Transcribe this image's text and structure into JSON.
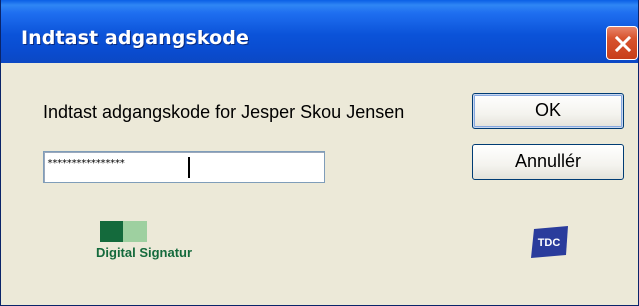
{
  "window": {
    "title": "Indtast adgangskode"
  },
  "dialog": {
    "prompt": "Indtast adgangskode for Jesper Skou Jensen",
    "password_masked": "****************",
    "ok_label": "OK",
    "cancel_label": "Annullér"
  },
  "logos": {
    "digital_signatur_text": "Digital Signatur",
    "tdc_text": "TDC"
  },
  "colors": {
    "titlebar": "#0b53d9",
    "dialog_background": "#ece9d8",
    "close_button": "#d8542f",
    "digital_signatur_green": "#146a3c",
    "tdc_blue": "#2a3c9c"
  },
  "icons": {
    "close": "close-icon"
  }
}
